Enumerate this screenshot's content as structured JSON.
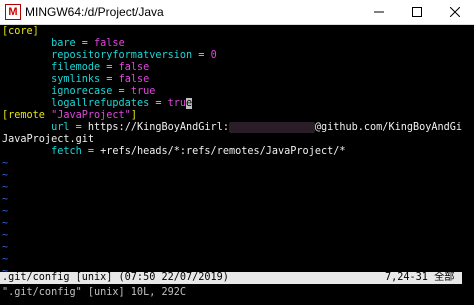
{
  "window": {
    "title": "MINGW64:/d/Project/Java",
    "app_icon_letter": "M"
  },
  "editor": {
    "l1_section": "[core]",
    "l2_key": "bare",
    "l2_eq": " = ",
    "l2_val": "false",
    "l3_key": "repositoryformatversion",
    "l3_eq": " = ",
    "l3_val": "0",
    "l4_key": "filemode",
    "l4_eq": " = ",
    "l4_val": "false",
    "l5_key": "symlinks",
    "l5_eq": " = ",
    "l5_val": "false",
    "l6_key": "ignorecase",
    "l6_eq": " = ",
    "l6_val": "true",
    "l7_key": "logallrefupdates",
    "l7_eq": " = ",
    "l7_val_pre": "tru",
    "l7_cursor": "e",
    "l8_section_a": "[remote ",
    "l8_string": "\"JavaProject\"",
    "l8_section_b": "]",
    "l9_key": "url",
    "l9_eq": " = ",
    "l9_val_a": "https://KingBoyAndGirl:",
    "l9_val_b": "@github.com/KingBoyAndGirl/",
    "l10_text": "JavaProject.git",
    "l11_key": "fetch",
    "l11_eq": " = ",
    "l11_val": "+refs/heads/*:refs/remotes/JavaProject/*",
    "tilde": "~"
  },
  "status": {
    "file": ".git/config [unix] (07:50 22/07/2019)",
    "position": "7,24-31 全部",
    "message": "\".git/config\" [unix] 10L, 292C"
  },
  "colors": {
    "section": "#e5e510",
    "key": "#1ad7d7",
    "value": "#e046e0",
    "tilde": "#2a63d8"
  }
}
